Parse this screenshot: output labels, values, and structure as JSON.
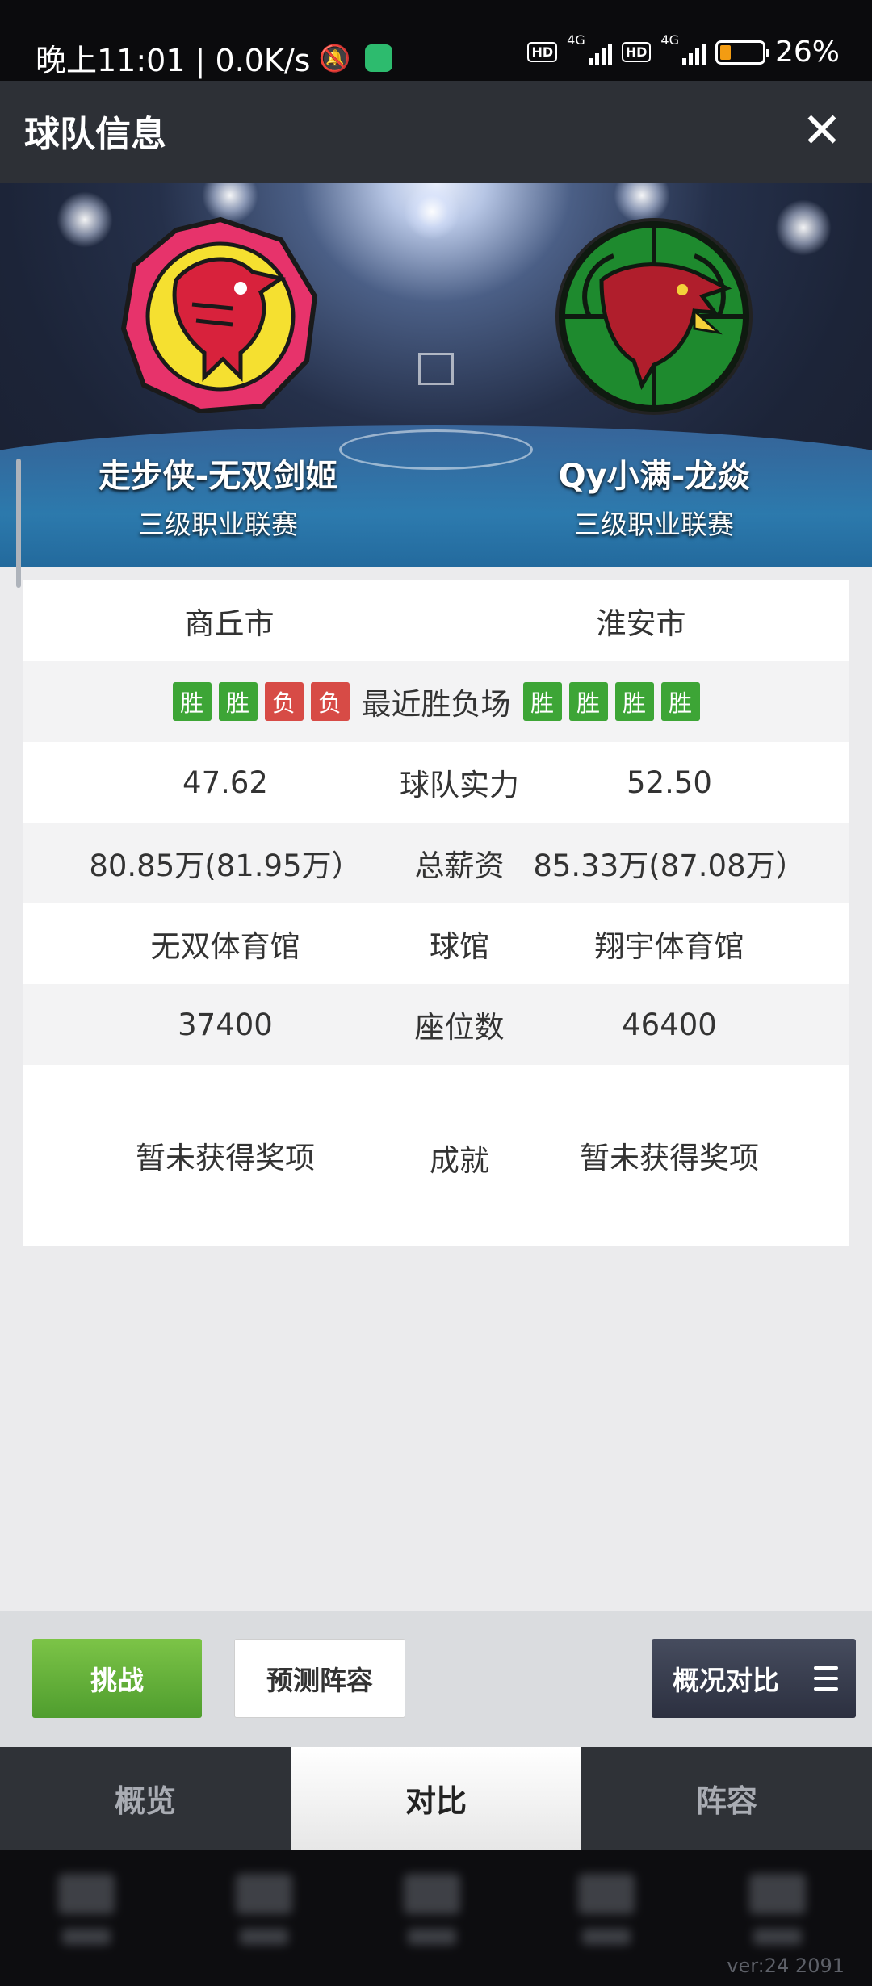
{
  "status_bar": {
    "time_speed": "晚上11:01 | 0.0K/s",
    "hd1": "HD",
    "net1": "4G",
    "hd2": "HD",
    "net2": "4G",
    "battery": "26%"
  },
  "header": {
    "title": "球队信息",
    "close": "✕"
  },
  "teams": {
    "left": {
      "name": "走步侠-无双剑姬",
      "league": "三级职业联赛"
    },
    "right": {
      "name": "Qy小满-龙焱",
      "league": "三级职业联赛"
    }
  },
  "compare": {
    "city": {
      "left": "商丘市",
      "right": "淮安市"
    },
    "recent": {
      "label": "最近胜负场",
      "left": [
        "胜",
        "胜",
        "负",
        "负"
      ],
      "right": [
        "胜",
        "胜",
        "胜",
        "胜"
      ]
    },
    "strength": {
      "label": "球队实力",
      "left": "47.62",
      "right": "52.50"
    },
    "salary": {
      "label": "总薪资",
      "left": "80.85万(81.95万）",
      "right": "85.33万(87.08万）"
    },
    "arena": {
      "label": "球馆",
      "left": "无双体育馆",
      "right": "翔宇体育馆"
    },
    "seats": {
      "label": "座位数",
      "left": "37400",
      "right": "46400"
    },
    "achievement": {
      "label": "成就",
      "left": "暂未获得奖项",
      "right": "暂未获得奖项"
    }
  },
  "actions": {
    "challenge": "挑战",
    "predict": "预测阵容",
    "overview_compare": "概况对比"
  },
  "tabs": [
    "概览",
    "对比",
    "阵容"
  ],
  "active_tab": 1,
  "version": "ver:24  2091",
  "colors": {
    "win": "#3da536",
    "lose": "#d74b46",
    "challenge_green": "#5fae37",
    "title_bar": "#2d3036"
  },
  "icons": {
    "close": "close-icon",
    "menu": "menu-icon",
    "left_logo": "phoenix-logo",
    "right_logo": "dragon-logo"
  }
}
